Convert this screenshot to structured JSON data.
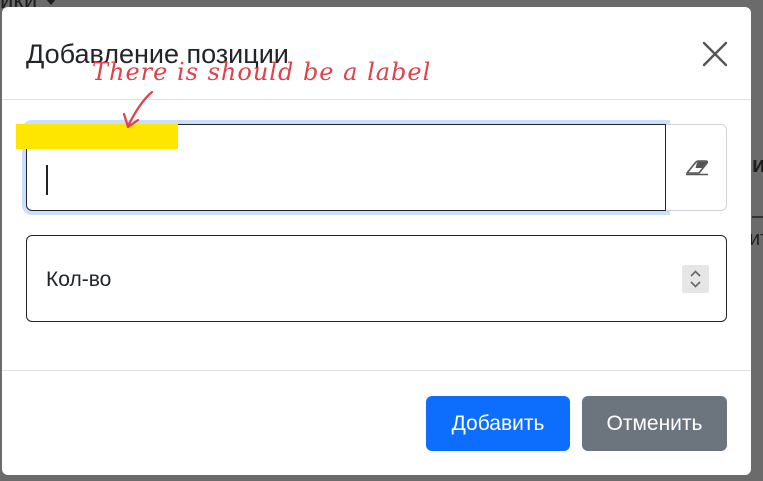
{
  "background": {
    "top_text": "ики",
    "right_header": "и",
    "right_cell": "ит"
  },
  "modal": {
    "title": "Добавление позиции",
    "annotation": "There is should be a label",
    "quantity_placeholder": "Кол-во",
    "buttons": {
      "add": "Добавить",
      "cancel": "Отменить"
    }
  },
  "colors": {
    "primary": "#0d6efd",
    "secondary": "#6c757d",
    "annotation": "#e0404a",
    "highlight": "#ffe600"
  },
  "icons": {
    "close": "close-icon",
    "clear": "eraser-icon",
    "spinner": "spinner-icon"
  }
}
